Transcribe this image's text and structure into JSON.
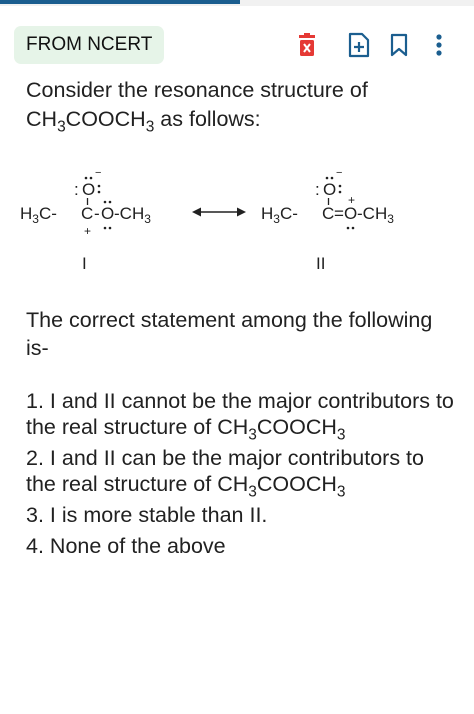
{
  "header": {
    "tag_label": "FROM NCERT",
    "icons": [
      "delete-icon",
      "add-file-icon",
      "bookmark-icon",
      "more-vert-icon"
    ],
    "accent_color": "#1b5e8f",
    "tag_bg": "#e6f4e8",
    "delete_color": "#e53935"
  },
  "question": {
    "line1": "Consider the resonance structure of",
    "formula_pre": "CH",
    "formula_sub1": "3",
    "formula_mid": "COOCH",
    "formula_sub2": "3",
    "line2_tail": " as follows:"
  },
  "structures": {
    "I": {
      "h3c": "H",
      "h3c_sub": "3",
      "h3c_tail": "C-",
      "c": "C",
      "dash1": "-",
      "o": "O",
      "dash2": "-CH",
      "ch3_sub": "3",
      "o_top": "O",
      "o_top_colon": ":",
      "label": "I",
      "o_charge": "−",
      "c_charge": "+"
    },
    "II": {
      "h3c": "H",
      "h3c_sub": "3",
      "h3c_tail": "C-",
      "c": "C",
      "dbl": "=",
      "o": "O",
      "dash2": "-CH",
      "ch3_sub": "3",
      "o_top": "O",
      "o_top_colon": ":",
      "label": "II",
      "o_charge": "−",
      "o_plus": "+"
    }
  },
  "statement": "The correct statement among the following is-",
  "options": [
    {
      "num": "1.",
      "text": "I and II cannot be the major contributors to the real structure of ",
      "f_pre": "CH",
      "f_s1": "3",
      "f_mid": "COOCH",
      "f_s2": "3"
    },
    {
      "num": "2.",
      "text": "I and II can be the major contributors to the real structure of ",
      "f_pre": "CH",
      "f_s1": "3",
      "f_mid": "COOCH",
      "f_s2": "3"
    },
    {
      "num": "3.",
      "text": "I is more stable than II."
    },
    {
      "num": "4.",
      "text": "None of the above"
    }
  ]
}
